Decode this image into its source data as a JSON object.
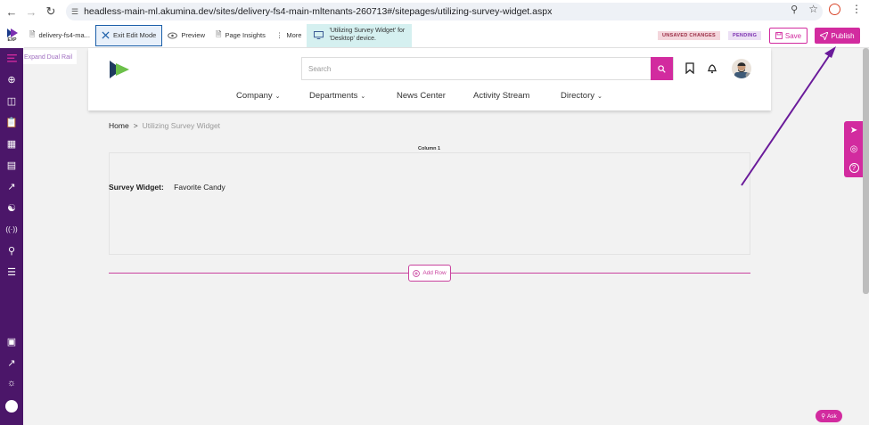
{
  "browser": {
    "url": "headless-main-ml.akumina.dev/sites/delivery-fs4-main-mltenants-260713#/sitepages/utilizing-survey-widget.aspx"
  },
  "toolbar": {
    "logo_text": "EXP",
    "site_tab": "delivery-fs4-ma...",
    "exit_edit": "Exit Edit Mode",
    "preview": "Preview",
    "page_insights": "Page Insights",
    "more": "More",
    "device_info_line1": "'Utilizing Survey Widget' for",
    "device_info_line2": "'Desktop' device.",
    "unsaved_badge": "UNSAVED CHANGES",
    "pending_badge": "PENDING",
    "save": "Save",
    "publish": "Publish"
  },
  "rail": {
    "expand_label": "Expand Dual Rail"
  },
  "header": {
    "search_placeholder": "Search",
    "nav": [
      {
        "label": "Company",
        "dropdown": true
      },
      {
        "label": "Departments",
        "dropdown": true
      },
      {
        "label": "News Center",
        "dropdown": false
      },
      {
        "label": "Activity Stream",
        "dropdown": false
      },
      {
        "label": "Directory",
        "dropdown": true
      }
    ]
  },
  "breadcrumb": {
    "home": "Home",
    "separator": ">",
    "current": "Utilizing Survey Widget"
  },
  "content": {
    "column_label": "Column 1",
    "survey_label": "Survey Widget:",
    "survey_value": "Favorite Candy",
    "add_row": "Add Row"
  },
  "ask": {
    "label": "Ask"
  },
  "colors": {
    "accent": "#d22b9f",
    "rail": "#4b1669",
    "annotation_arrow": "#6a1b9a"
  }
}
